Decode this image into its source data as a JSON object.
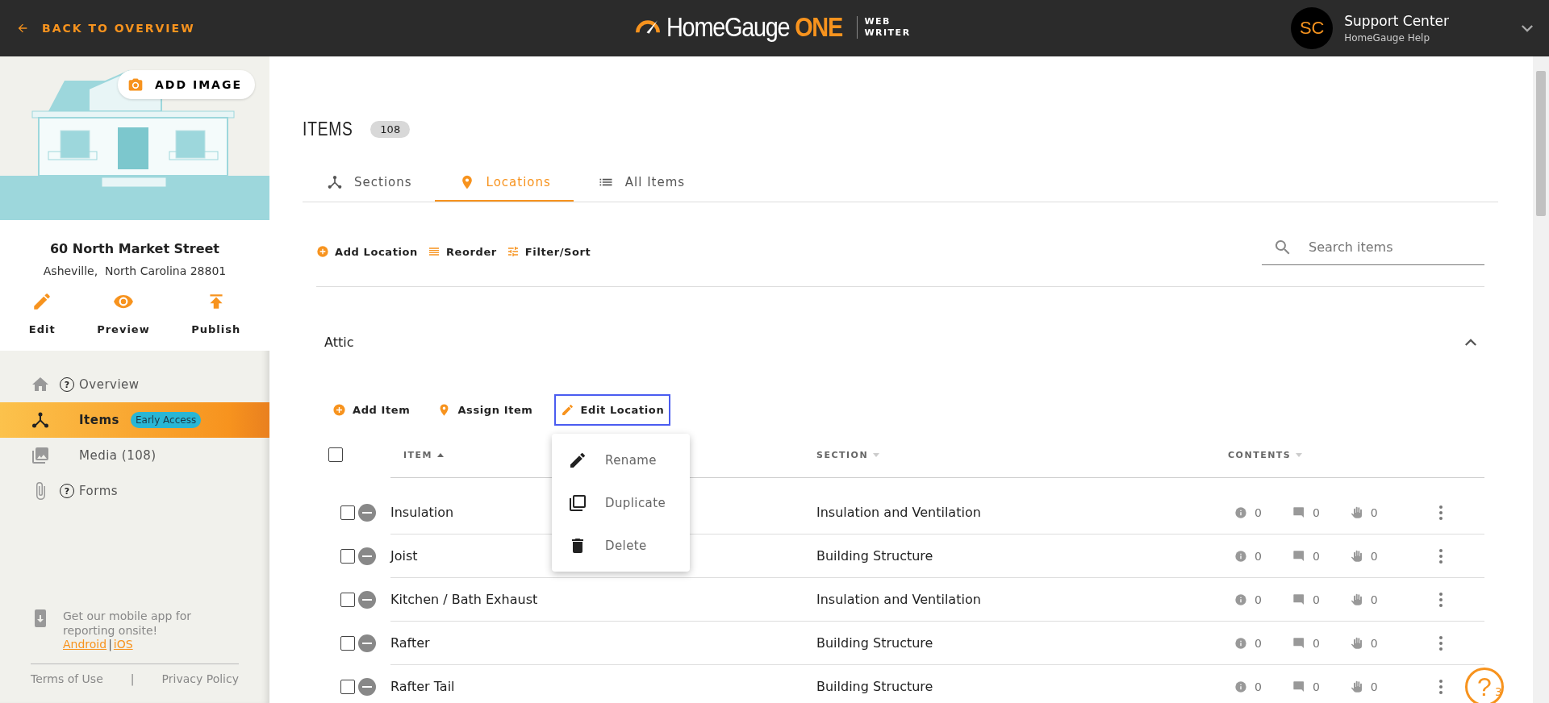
{
  "header": {
    "back_link": "BACK TO OVERVIEW",
    "logo": {
      "brand": "HomeGauge",
      "accent": "ONE",
      "line1": "WEB",
      "line2": "WRITER"
    },
    "user": {
      "initials": "SC",
      "name": "Support Center",
      "subtitle": "HomeGauge Help"
    }
  },
  "sidebar": {
    "add_image": "ADD IMAGE",
    "address": "60 North Market Street",
    "city": "Asheville,  North Carolina 28801",
    "actions": [
      "Edit",
      "Preview",
      "Publish"
    ],
    "nav": [
      {
        "label": "Overview",
        "help_mark": "?",
        "selected": false
      },
      {
        "label": "Items",
        "badge": "Early Access",
        "selected": true
      },
      {
        "label": "Media (108)",
        "selected": false
      },
      {
        "label": "Forms",
        "help_mark": "?",
        "selected": false
      }
    ],
    "promo": {
      "text": "Get our mobile app for reporting onsite!",
      "links": [
        "Android",
        "iOS"
      ],
      "separator": "|"
    },
    "footer_links": [
      "Terms of Use",
      "Privacy Policy"
    ],
    "footer_separator": "|"
  },
  "main": {
    "title": "ITEMS",
    "count": "108",
    "tabs": [
      {
        "label": "Sections",
        "selected": false
      },
      {
        "label": "Locations",
        "selected": true
      },
      {
        "label": "All Items",
        "selected": false
      }
    ],
    "toolbar": [
      "Add Location",
      "Reorder",
      "Filter/Sort"
    ],
    "search": {
      "placeholder": "Search items"
    },
    "location": {
      "name": "Attic",
      "expanded": true,
      "actions": [
        {
          "label": "Add Item",
          "focused": false
        },
        {
          "label": "Assign Item",
          "focused": false
        },
        {
          "label": "Edit Location",
          "focused": true
        }
      ],
      "menu": [
        "Rename",
        "Duplicate",
        "Delete"
      ],
      "select_all_checked": false,
      "columns": [
        {
          "label": "ITEM",
          "sorted": true
        },
        {
          "label": "SECTION",
          "sorted": false
        },
        {
          "label": "CONTENTS",
          "sorted": false
        }
      ],
      "rows": [
        {
          "name": "Insulation",
          "section": "Insulation and Ventilation",
          "checked": false,
          "counts": [
            "0",
            "0",
            "0"
          ]
        },
        {
          "name": "Joist",
          "section": "Building Structure",
          "checked": false,
          "counts": [
            "0",
            "0",
            "0"
          ]
        },
        {
          "name": "Kitchen / Bath Exhaust",
          "section": "Insulation and Ventilation",
          "checked": false,
          "counts": [
            "0",
            "0",
            "0"
          ]
        },
        {
          "name": "Rafter",
          "section": "Building Structure",
          "checked": false,
          "counts": [
            "0",
            "0",
            "0"
          ]
        },
        {
          "name": "Rafter Tail",
          "section": "Building Structure",
          "checked": false,
          "counts": [
            "0",
            "0",
            "0"
          ]
        }
      ]
    }
  },
  "help": {
    "symbol": "?",
    "count": "3"
  }
}
